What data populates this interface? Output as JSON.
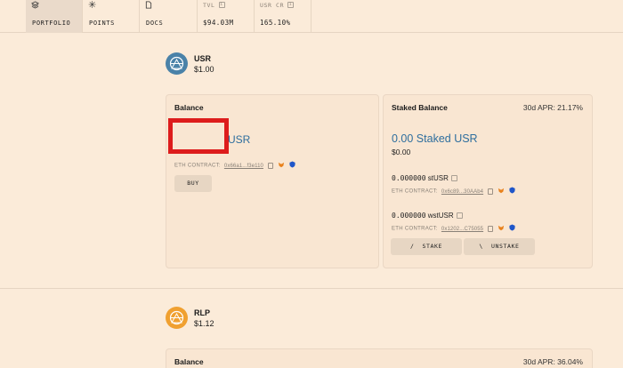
{
  "nav": {
    "tabs": [
      {
        "label": "PORTFOLIO",
        "icon": "layers-icon"
      },
      {
        "label": "POINTS",
        "icon": "asterisk-icon"
      },
      {
        "label": "DOCS",
        "icon": "document-icon"
      }
    ],
    "stats": [
      {
        "label": "TVL",
        "value": "$94.03M"
      },
      {
        "label": "USR CR",
        "value": "165.10%"
      }
    ]
  },
  "usr": {
    "name": "USR",
    "price": "$1.00",
    "balance": {
      "title": "Balance",
      "amount_unit": "USR",
      "contract_label": "ETH CONTRACT:",
      "contract_addr": "0x66a1...f3e110",
      "buy_label": "BUY"
    },
    "staked": {
      "title": "Staked Balance",
      "apr": "30d APR: 21.17%",
      "headline": "0.00 Staked USR",
      "usd": "$0.00",
      "items": [
        {
          "amount": "0.000000",
          "unit": "stUSR",
          "contract_label": "ETH CONTRACT:",
          "contract_addr": "0x6c89...30AAb4"
        },
        {
          "amount": "0.000000",
          "unit": "wstUSR",
          "contract_label": "ETH CONTRACT:",
          "contract_addr": "0x1202...C75055"
        }
      ],
      "stake_label": "STAKE",
      "unstake_label": "UNSTAKE"
    }
  },
  "rlp": {
    "name": "RLP",
    "price": "$1.12",
    "balance": {
      "title": "Balance"
    },
    "apr": "30d APR: 36.04%"
  },
  "colors": {
    "background": "#fbebd9",
    "accent_blue": "#2e6e9e",
    "usr_logo": "#4a82a8",
    "rlp_logo": "#f0a030",
    "highlight_red": "#dd1c1c"
  }
}
